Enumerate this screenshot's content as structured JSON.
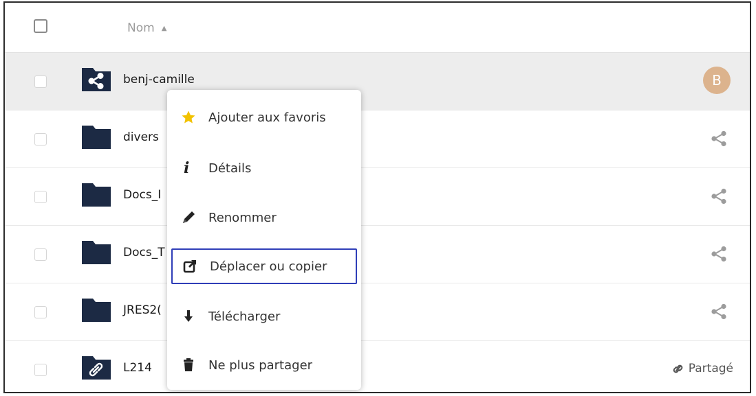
{
  "table": {
    "header": {
      "name_label": "Nom"
    },
    "rows": [
      {
        "name": "benj-camille",
        "right": "avatar",
        "avatar_letter": "B",
        "icon": "share-folder-icon"
      },
      {
        "name": "divers",
        "right": "share",
        "icon": "folder-icon"
      },
      {
        "name": "Docs_I",
        "right": "share",
        "icon": "folder-icon"
      },
      {
        "name": "Docs_T",
        "right": "share",
        "icon": "folder-icon"
      },
      {
        "name": "JRES2(",
        "right": "share",
        "icon": "folder-icon"
      },
      {
        "name": "L214",
        "right": "shared",
        "shared_label": "Partagé",
        "icon": "link-folder-icon"
      }
    ]
  },
  "context_menu": {
    "items": [
      {
        "label": "Ajouter aux favoris",
        "icon": "star-icon"
      },
      {
        "label": "Détails",
        "icon": "info-icon"
      },
      {
        "label": "Renommer",
        "icon": "pencil-icon"
      },
      {
        "label": "Déplacer ou copier",
        "icon": "external-link-icon",
        "selected": true
      },
      {
        "label": "Télécharger",
        "icon": "download-icon"
      },
      {
        "label": "Ne plus partager",
        "icon": "trash-icon"
      }
    ]
  },
  "colors": {
    "folder": "#1c2a44",
    "avatar": "#dcb38d",
    "highlight_row": "#ededed",
    "selection_border": "#2f3eb8",
    "star": "#f2c200"
  }
}
